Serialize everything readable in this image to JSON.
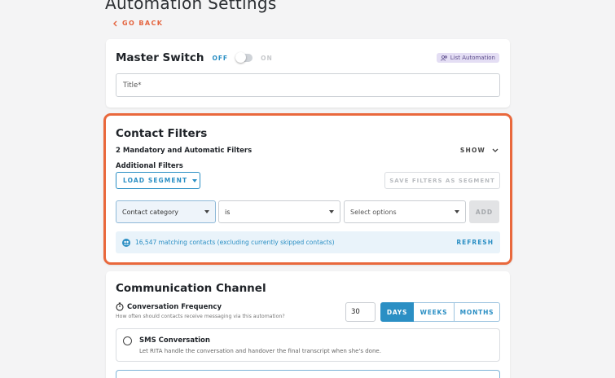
{
  "page": {
    "title": "Automation Settings",
    "go_back": "GO BACK"
  },
  "master_switch": {
    "title": "Master Switch",
    "off_label": "OFF",
    "on_label": "ON",
    "state": "off",
    "list_automation_label": "List Automation",
    "title_field_placeholder": "Title*"
  },
  "contact_filters": {
    "title": "Contact Filters",
    "mandatory_label": "2 Mandatory and Automatic Filters",
    "show_label": "SHOW",
    "additional_label": "Additional Filters",
    "load_segment_label": "LOAD SEGMENT",
    "save_segment_label": "SAVE FILTERS AS SEGMENT",
    "filter_row": {
      "field": "Contact category",
      "operator": "is",
      "value_placeholder": "Select options",
      "add_label": "ADD"
    },
    "match_text": "16,547 matching contacts (excluding currently skipped contacts)",
    "refresh_label": "REFRESH"
  },
  "communication": {
    "title": "Communication Channel",
    "frequency_title": "Conversation Frequency",
    "frequency_subtitle": "How often should contacts receive messaging via this automation?",
    "frequency_value": "30",
    "units": [
      "DAYS",
      "WEEKS",
      "MONTHS"
    ],
    "selected_unit": "DAYS",
    "sms_title": "SMS Conversation",
    "sms_subtitle": "Let RITA handle the conversation and handover the final transcript when she's done."
  },
  "colors": {
    "accent": "#2b8fc4",
    "highlight_border": "#e9683c",
    "go_back": "#e4643f"
  }
}
